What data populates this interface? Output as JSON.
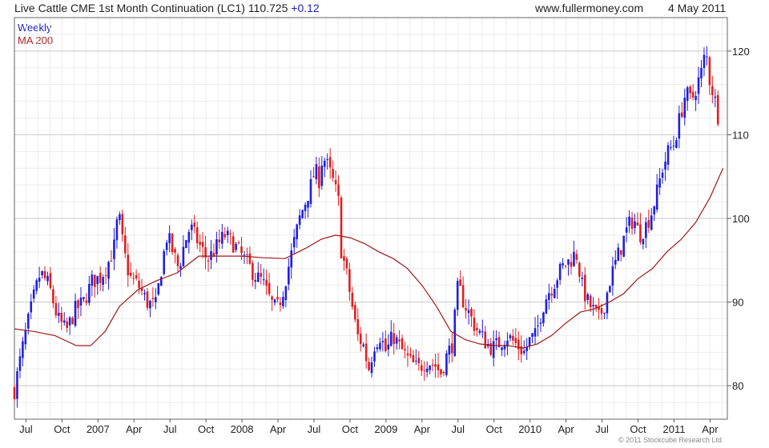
{
  "header": {
    "instrument": "Live Cattle CME 1st Month Continuation (LC1)",
    "last": "110.725",
    "change": "+0.12",
    "site": "www.fullermoney.com",
    "date": "4 May 2011"
  },
  "legend": {
    "series1": "Weekly",
    "series2": "MA 200"
  },
  "copyright": "© 2011 Stockcube Research Ltd",
  "colors": {
    "up": "#1f1fe0",
    "down": "#e01f1f",
    "ma": "#a01818",
    "grid": "#d8d8d8"
  },
  "chart_data": {
    "type": "bar",
    "subtype": "weekly candlestick with 200-day moving average",
    "grid": true,
    "y_axis_side": "right",
    "ylim": [
      76,
      124
    ],
    "yticks": [
      80,
      90,
      100,
      110,
      120
    ],
    "xlim": [
      2006.42,
      2011.37
    ],
    "xticks": [
      {
        "label": "Jul",
        "t": 2006.5
      },
      {
        "label": "Oct",
        "t": 2006.75
      },
      {
        "label": "2007",
        "t": 2007.0
      },
      {
        "label": "Apr",
        "t": 2007.25
      },
      {
        "label": "Jul",
        "t": 2007.5
      },
      {
        "label": "Oct",
        "t": 2007.75
      },
      {
        "label": "2008",
        "t": 2008.0
      },
      {
        "label": "Apr",
        "t": 2008.25
      },
      {
        "label": "Jul",
        "t": 2008.5
      },
      {
        "label": "Oct",
        "t": 2008.75
      },
      {
        "label": "2009",
        "t": 2009.0
      },
      {
        "label": "Apr",
        "t": 2009.25
      },
      {
        "label": "Jul",
        "t": 2009.5
      },
      {
        "label": "Oct",
        "t": 2009.75
      },
      {
        "label": "2010",
        "t": 2010.0
      },
      {
        "label": "Apr",
        "t": 2010.25
      },
      {
        "label": "Jul",
        "t": 2010.5
      },
      {
        "label": "Oct",
        "t": 2010.75
      },
      {
        "label": "2011",
        "t": 2011.0
      },
      {
        "label": "Apr",
        "t": 2011.25
      }
    ],
    "price_path": [
      [
        2006.42,
        79.5
      ],
      [
        2006.47,
        84
      ],
      [
        2006.52,
        88
      ],
      [
        2006.56,
        91
      ],
      [
        2006.6,
        93.5
      ],
      [
        2006.66,
        92
      ],
      [
        2006.72,
        88
      ],
      [
        2006.78,
        86.5
      ],
      [
        2006.84,
        89
      ],
      [
        2006.9,
        90
      ],
      [
        2006.96,
        92.5
      ],
      [
        2007.02,
        93
      ],
      [
        2007.08,
        95
      ],
      [
        2007.12,
        97
      ],
      [
        2007.14,
        101
      ],
      [
        2007.18,
        96
      ],
      [
        2007.22,
        93
      ],
      [
        2007.28,
        92
      ],
      [
        2007.34,
        90
      ],
      [
        2007.4,
        89.5
      ],
      [
        2007.44,
        94
      ],
      [
        2007.48,
        98
      ],
      [
        2007.52,
        96
      ],
      [
        2007.56,
        94
      ],
      [
        2007.6,
        97
      ],
      [
        2007.64,
        99
      ],
      [
        2007.7,
        97
      ],
      [
        2007.76,
        95
      ],
      [
        2007.82,
        96.5
      ],
      [
        2007.88,
        98
      ],
      [
        2007.94,
        97
      ],
      [
        2008.0,
        95.5
      ],
      [
        2008.06,
        94
      ],
      [
        2008.1,
        93
      ],
      [
        2008.14,
        92.5
      ],
      [
        2008.2,
        90
      ],
      [
        2008.24,
        89
      ],
      [
        2008.28,
        91
      ],
      [
        2008.32,
        94
      ],
      [
        2008.36,
        97
      ],
      [
        2008.4,
        100
      ],
      [
        2008.44,
        102
      ],
      [
        2008.48,
        104
      ],
      [
        2008.51,
        106
      ],
      [
        2008.53,
        104
      ],
      [
        2008.56,
        107.5
      ],
      [
        2008.6,
        106
      ],
      [
        2008.64,
        104
      ],
      [
        2008.67,
        102
      ],
      [
        2008.69,
        96
      ],
      [
        2008.72,
        94
      ],
      [
        2008.76,
        90
      ],
      [
        2008.8,
        86
      ],
      [
        2008.84,
        85
      ],
      [
        2008.88,
        82
      ],
      [
        2008.92,
        85
      ],
      [
        2008.96,
        86
      ],
      [
        2009.0,
        84
      ],
      [
        2009.05,
        86
      ],
      [
        2009.1,
        84.5
      ],
      [
        2009.16,
        83
      ],
      [
        2009.22,
        82
      ],
      [
        2009.28,
        83
      ],
      [
        2009.34,
        82.5
      ],
      [
        2009.38,
        81.5
      ],
      [
        2009.42,
        83.5
      ],
      [
        2009.46,
        85
      ],
      [
        2009.5,
        92
      ],
      [
        2009.54,
        90
      ],
      [
        2009.58,
        88.5
      ],
      [
        2009.62,
        87
      ],
      [
        2009.66,
        86
      ],
      [
        2009.7,
        85
      ],
      [
        2009.74,
        84.5
      ],
      [
        2009.78,
        85
      ],
      [
        2009.84,
        86
      ],
      [
        2009.9,
        85
      ],
      [
        2009.96,
        84
      ],
      [
        2010.0,
        85.5
      ],
      [
        2010.04,
        86
      ],
      [
        2010.08,
        89
      ],
      [
        2010.12,
        91
      ],
      [
        2010.16,
        92
      ],
      [
        2010.2,
        93.5
      ],
      [
        2010.24,
        94.5
      ],
      [
        2010.28,
        95
      ],
      [
        2010.32,
        96
      ],
      [
        2010.36,
        92
      ],
      [
        2010.4,
        90
      ],
      [
        2010.44,
        89
      ],
      [
        2010.48,
        88
      ],
      [
        2010.52,
        90
      ],
      [
        2010.56,
        93
      ],
      [
        2010.6,
        95
      ],
      [
        2010.64,
        97
      ],
      [
        2010.68,
        99
      ],
      [
        2010.72,
        100
      ],
      [
        2010.76,
        98
      ],
      [
        2010.8,
        99
      ],
      [
        2010.84,
        100.5
      ],
      [
        2010.88,
        103
      ],
      [
        2010.92,
        106
      ],
      [
        2010.96,
        108
      ],
      [
        2011.0,
        109
      ],
      [
        2011.04,
        112
      ],
      [
        2011.08,
        115
      ],
      [
        2011.12,
        114
      ],
      [
        2011.16,
        116
      ],
      [
        2011.2,
        118
      ],
      [
        2011.22,
        120.5
      ],
      [
        2011.24,
        117
      ],
      [
        2011.28,
        114.5
      ],
      [
        2011.32,
        111
      ]
    ],
    "ma200": [
      [
        2006.42,
        86.8
      ],
      [
        2006.55,
        86.5
      ],
      [
        2006.7,
        86
      ],
      [
        2006.85,
        84.8
      ],
      [
        2006.95,
        84.8
      ],
      [
        2007.05,
        86.5
      ],
      [
        2007.15,
        89.5
      ],
      [
        2007.28,
        91.5
      ],
      [
        2007.4,
        92.5
      ],
      [
        2007.55,
        93.5
      ],
      [
        2007.7,
        95.5
      ],
      [
        2007.85,
        95.5
      ],
      [
        2008.0,
        95.5
      ],
      [
        2008.15,
        95.3
      ],
      [
        2008.3,
        95.2
      ],
      [
        2008.45,
        96.5
      ],
      [
        2008.55,
        97.5
      ],
      [
        2008.65,
        98
      ],
      [
        2008.75,
        97.7
      ],
      [
        2008.85,
        97
      ],
      [
        2008.95,
        96
      ],
      [
        2009.05,
        95.2
      ],
      [
        2009.15,
        94
      ],
      [
        2009.25,
        92
      ],
      [
        2009.35,
        89.5
      ],
      [
        2009.45,
        86.5
      ],
      [
        2009.55,
        85.5
      ],
      [
        2009.65,
        85
      ],
      [
        2009.75,
        84.8
      ],
      [
        2009.85,
        84.8
      ],
      [
        2009.95,
        84.5
      ],
      [
        2010.05,
        85
      ],
      [
        2010.15,
        86
      ],
      [
        2010.25,
        87.5
      ],
      [
        2010.35,
        88.8
      ],
      [
        2010.45,
        89.2
      ],
      [
        2010.55,
        90
      ],
      [
        2010.65,
        91
      ],
      [
        2010.75,
        92.8
      ],
      [
        2010.85,
        94
      ],
      [
        2010.95,
        96
      ],
      [
        2011.05,
        97.5
      ],
      [
        2011.15,
        99.5
      ],
      [
        2011.25,
        102.5
      ],
      [
        2011.34,
        106
      ]
    ]
  }
}
